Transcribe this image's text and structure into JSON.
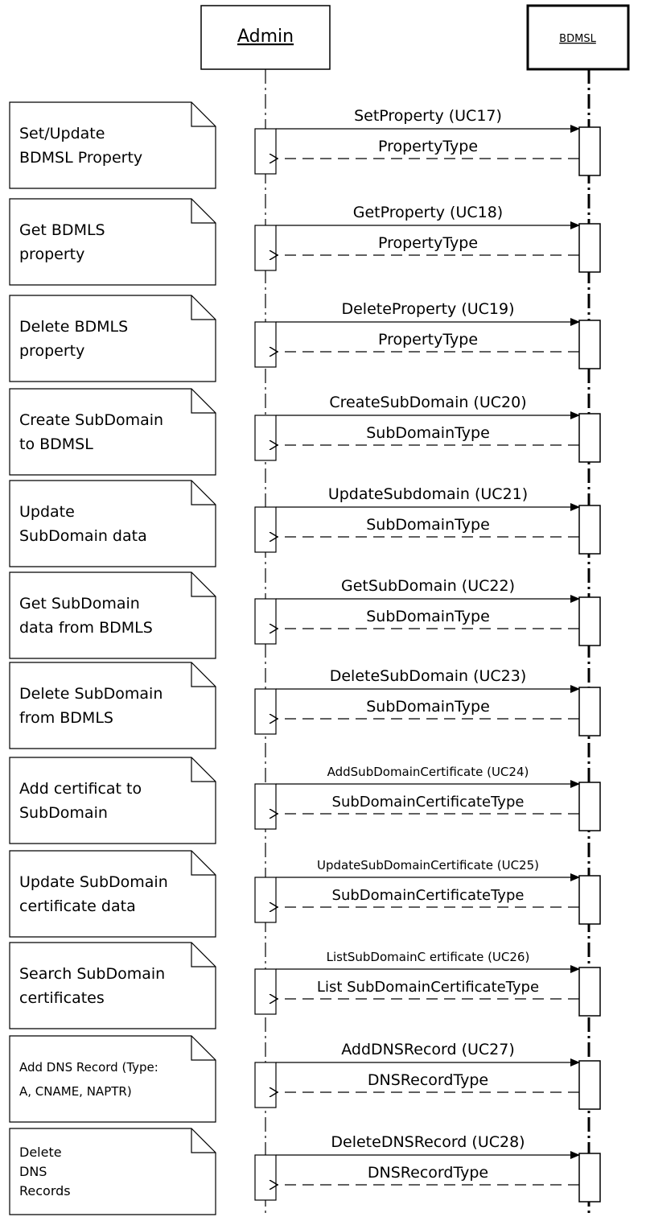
{
  "participants": {
    "admin": "Admin",
    "bdmsl": "BDMSL"
  },
  "steps": [
    {
      "note": [
        "Set/Update",
        "BDMSL Property"
      ],
      "request": "SetProperty (UC17)",
      "response": "PropertyType"
    },
    {
      "note": [
        "Get BDMLS",
        "property"
      ],
      "request": "GetProperty (UC18)",
      "response": "PropertyType"
    },
    {
      "note": [
        "Delete BDMLS",
        "property"
      ],
      "request": "DeleteProperty (UC19)",
      "response": "PropertyType"
    },
    {
      "note": [
        "Create SubDomain",
        "to BDMSL"
      ],
      "request": "CreateSubDomain (UC20)",
      "response": "SubDomainType"
    },
    {
      "note": [
        "Update",
        "SubDomain data"
      ],
      "request": "UpdateSubdomain (UC21)",
      "response": "SubDomainType"
    },
    {
      "note": [
        "Get SubDomain",
        "data from BDMLS"
      ],
      "request": "GetSubDomain (UC22)",
      "response": "SubDomainType"
    },
    {
      "note": [
        "Delete SubDomain",
        "from BDMLS"
      ],
      "request": "DeleteSubDomain (UC23)",
      "response": "SubDomainType"
    },
    {
      "note": [
        "Add  certificat to",
        "SubDomain"
      ],
      "request": "AddSubDomainCertificate (UC24)",
      "response": "SubDomainCertificateType"
    },
    {
      "note": [
        "Update SubDomain",
        "certificate data"
      ],
      "request": "UpdateSubDomainCertificate (UC25)",
      "response": "SubDomainCertificateType"
    },
    {
      "note": [
        "Search SubDomain",
        "certificates"
      ],
      "request": "ListSubDomainC ertificate (UC26)",
      "response": "List SubDomainCertificateType"
    },
    {
      "note": [
        "Add DNS Record (Type:",
        "A, CNAME, NAPTR)"
      ],
      "request": "AddDNSRecord  (UC27)",
      "response": "DNSRecordType"
    },
    {
      "note": [
        "Delete",
        "DNS",
        "Records"
      ],
      "request": "DeleteDNSRecord  (UC28)",
      "response": "DNSRecordType"
    }
  ]
}
